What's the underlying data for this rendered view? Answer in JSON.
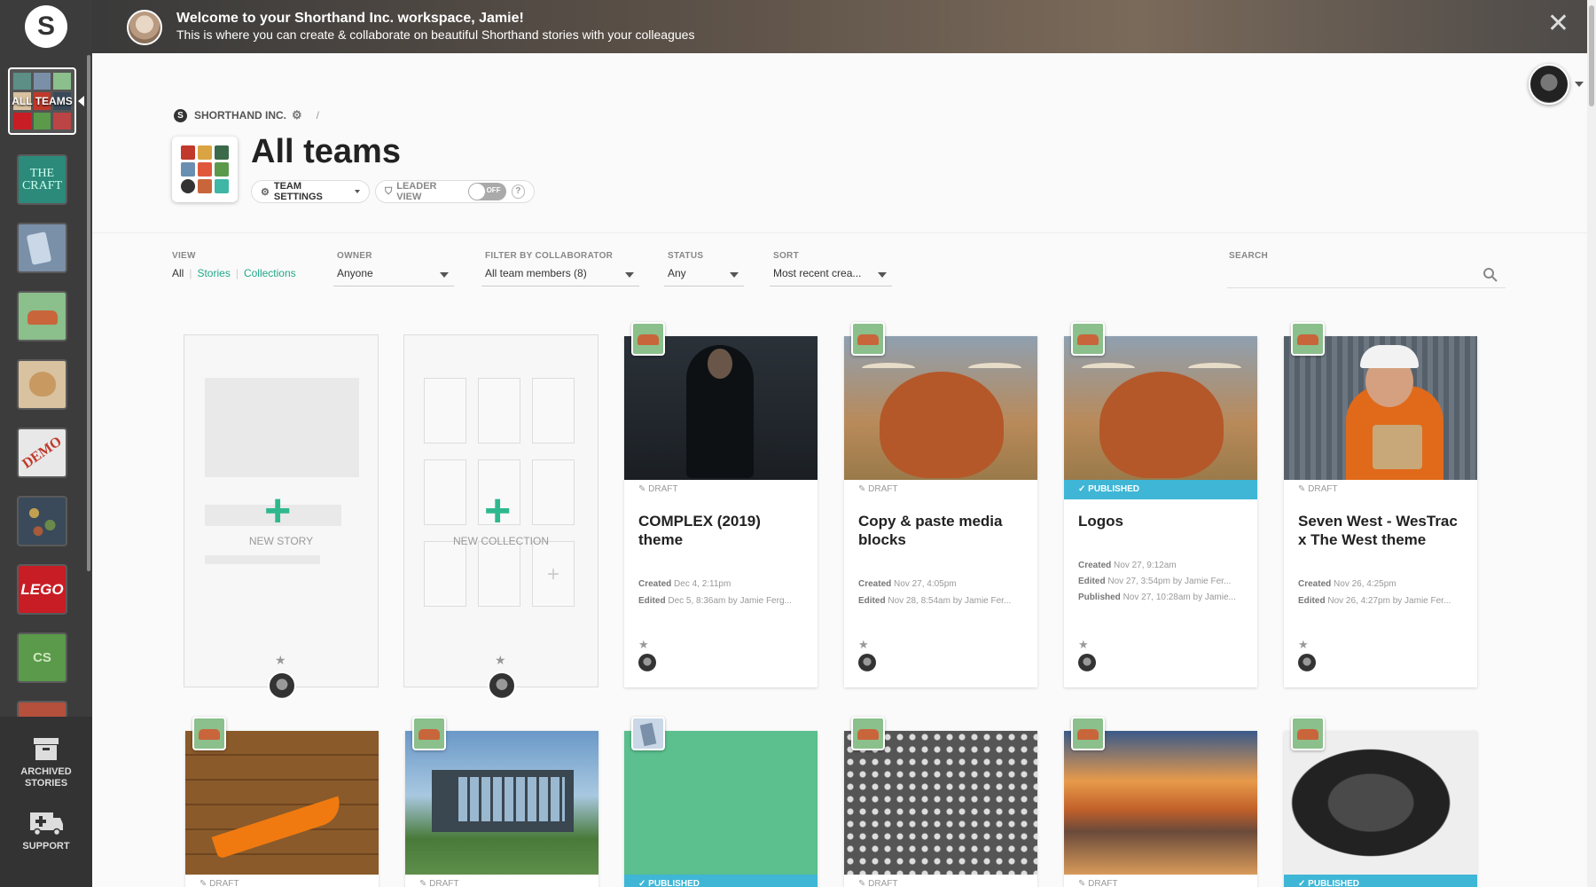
{
  "sidebar": {
    "logo": "S",
    "all_teams_label": "ALL TEAMS",
    "teams": [
      {
        "label": "THE CRAFT",
        "color": "#2c8a7a"
      },
      {
        "label": "",
        "color": "#7a8fa8"
      },
      {
        "label": "",
        "color": "#8bbf8b"
      },
      {
        "label": "",
        "color": "#d9c2a0"
      },
      {
        "label": "DEMO",
        "color": "#e8e8e8"
      },
      {
        "label": "",
        "color": "#3a4a5a"
      },
      {
        "label": "LEGO",
        "color": "#c81d25"
      },
      {
        "label": "CS",
        "color": "#5a9a4a"
      }
    ],
    "archived_label": "ARCHIVED STORIES",
    "support_label": "SUPPORT"
  },
  "banner": {
    "title": "Welcome to your Shorthand Inc. workspace, Jamie!",
    "subtitle": "This is where you can create & collaborate on beautiful Shorthand stories with your colleagues",
    "close": "✕"
  },
  "breadcrumb": {
    "org": "SHORTHAND INC.",
    "sep": "/"
  },
  "page": {
    "title": "All teams",
    "team_settings": "TEAM SETTINGS",
    "leader_view": "LEADER VIEW",
    "toggle_state": "OFF",
    "help": "?"
  },
  "filters": {
    "view_label": "VIEW",
    "view_all": "All",
    "view_stories": "Stories",
    "view_collections": "Collections",
    "owner_label": "OWNER",
    "owner_value": "Anyone",
    "collab_label": "FILTER BY COLLABORATOR",
    "collab_value": "All team members (8)",
    "status_label": "STATUS",
    "status_value": "Any",
    "sort_label": "SORT",
    "sort_value": "Most recent crea...",
    "search_label": "SEARCH"
  },
  "new_cards": {
    "story": "NEW STORY",
    "collection": "NEW COLLECTION"
  },
  "stories": [
    {
      "status": "DRAFT",
      "title": "COMPLEX (2019) theme",
      "created": "Dec 4, 2:11pm",
      "edited": "Dec 5, 8:36am by Jamie Ferg..."
    },
    {
      "status": "DRAFT",
      "title": "Copy & paste media blocks",
      "created": "Nov 27, 4:05pm",
      "edited": "Nov 28, 8:54am by Jamie Fer..."
    },
    {
      "status": "PUBLISHED",
      "title": "Logos",
      "created": "Nov 27, 9:12am",
      "edited": "Nov 27, 3:54pm by Jamie Fer...",
      "published": "Nov 27, 10:28am by Jamie..."
    },
    {
      "status": "DRAFT",
      "title": "Seven West - WesTrac x The West theme",
      "created": "Nov 26, 4:25pm",
      "edited": "Nov 26, 4:27pm by Jamie Fer..."
    }
  ],
  "meta_labels": {
    "created": "Created",
    "edited": "Edited",
    "published": "Published"
  },
  "row2_status": [
    "DRAFT",
    "DRAFT",
    "PUBLISHED",
    "DRAFT",
    "DRAFT",
    "PUBLISHED"
  ]
}
